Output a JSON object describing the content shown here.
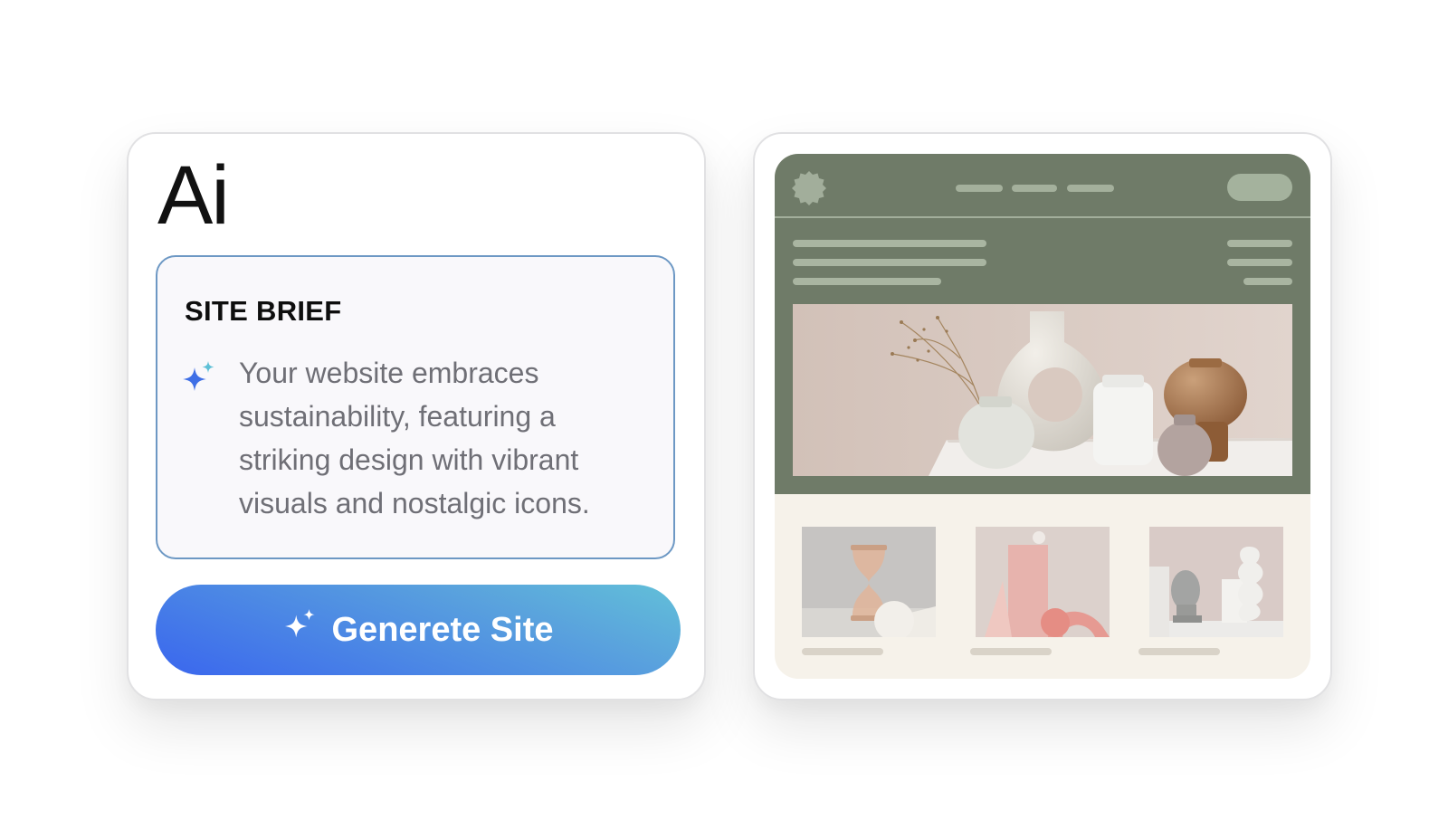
{
  "ai_panel": {
    "logo_text": "Ai",
    "brief": {
      "title": "SITE BRIEF",
      "icon": "sparkle-icon",
      "text": "Your website embraces sustainability, featuring a striking design with vibrant visuals and nostalgic icons."
    },
    "generate_button": {
      "label": "Generete Site",
      "icon": "sparkle-icon"
    }
  },
  "preview": {
    "header_color": "#6f7b68",
    "body_color": "#f6f2ea",
    "hero_image": "ceramic-vases-photo",
    "thumbnails": [
      "hourglass-photo",
      "pink-shapes-photo",
      "buddha-bust-photo"
    ]
  },
  "colors": {
    "accent_start": "#3a66ee",
    "accent_end": "#62c0d8",
    "brief_border": "#6d98c4"
  }
}
